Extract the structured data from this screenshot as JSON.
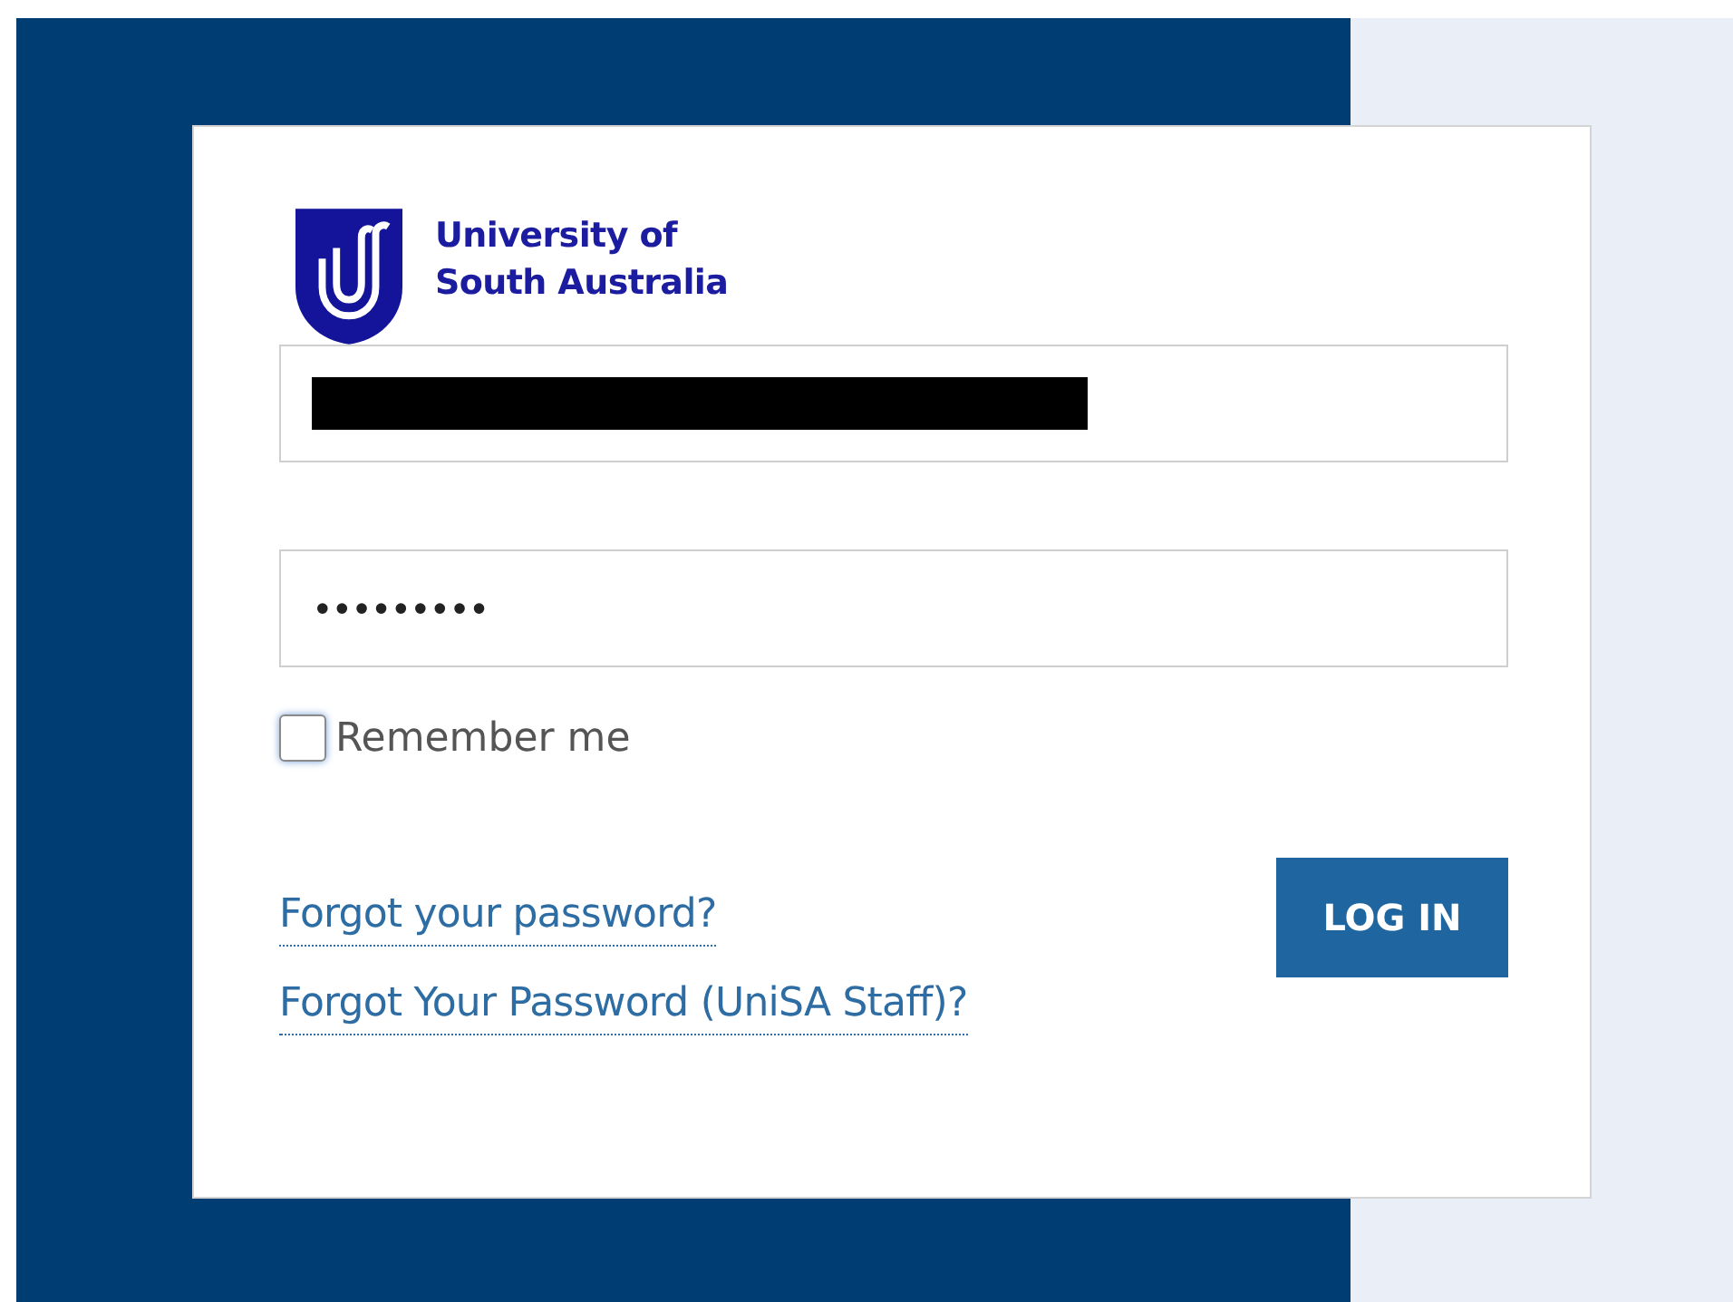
{
  "logo": {
    "line_1": "University of",
    "line_2": "South Australia"
  },
  "username": {
    "redacted": true
  },
  "password": {
    "value": "•••••••••"
  },
  "remember": {
    "label": "Remember me",
    "checked": false
  },
  "links": [
    "Forgot your password?",
    "Forgot Your Password (UniSA Staff)?"
  ],
  "login_button": "LOG IN"
}
